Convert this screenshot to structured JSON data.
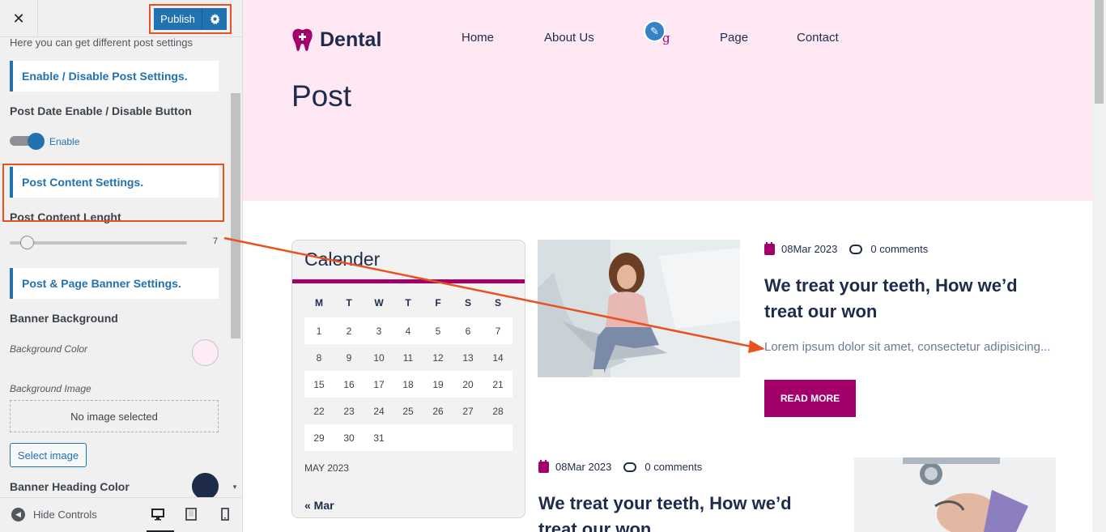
{
  "customizer": {
    "close_icon": "close-icon",
    "publish_label": "Publish",
    "settings_icon": "gear-icon",
    "panel_description": "Here you can get different post settings",
    "sections": {
      "enable_disable": "Enable / Disable Post Settings.",
      "post_content": "Post Content Settings.",
      "banner": "Post & Page Banner Settings."
    },
    "post_date": {
      "label": "Post Date Enable / Disable Button",
      "toggle_label": "Enable",
      "enabled": true
    },
    "content_length": {
      "label": "Post Content Lenght",
      "value": "7"
    },
    "banner_background_label": "Banner Background",
    "background_color_label": "Background Color",
    "background_color_value": "#fdebf6",
    "background_image_label": "Background Image",
    "no_image_text": "No image selected",
    "select_image_label": "Select image",
    "banner_heading_color_label": "Banner Heading Color",
    "banner_heading_color_value": "#1e2b4a",
    "footer": {
      "hide_controls_label": "Hide Controls",
      "devices": [
        "desktop",
        "tablet",
        "mobile"
      ],
      "active_device": "desktop"
    }
  },
  "site": {
    "logo_text": "Dental",
    "nav": [
      "Home",
      "About Us",
      "g",
      "Page",
      "Contact"
    ],
    "page_title": "Post",
    "colors": {
      "accent": "#a3006b",
      "banner_bg": "#fde8f4",
      "heading": "#1e2b4a",
      "publish": "#2271b1",
      "annotation": "#e8521f"
    }
  },
  "calendar": {
    "title": "Calender",
    "weekdays": [
      "M",
      "T",
      "W",
      "T",
      "F",
      "S",
      "S"
    ],
    "weeks": [
      [
        "",
        "",
        "",
        "",
        "",
        "",
        ""
      ],
      [
        "1",
        "2",
        "3",
        "4",
        "5",
        "6",
        "7"
      ],
      [
        "8",
        "9",
        "10",
        "11",
        "12",
        "13",
        "14"
      ],
      [
        "15",
        "16",
        "17",
        "18",
        "19",
        "20",
        "21"
      ],
      [
        "22",
        "23",
        "24",
        "25",
        "26",
        "27",
        "28"
      ],
      [
        "29",
        "30",
        "31",
        "",
        "",
        "",
        ""
      ]
    ],
    "caption": "MAY 2023",
    "prev_link": "« Mar"
  },
  "posts": [
    {
      "date": "08Mar 2023",
      "comments": "0 comments",
      "title_line1": "We treat your teeth, How we’d",
      "title_line2": "treat our won",
      "excerpt": "Lorem ipsum dolor sit amet, consectetur adipisicing...",
      "button": "READ MORE"
    },
    {
      "date": "08Mar 2023",
      "comments": "0 comments",
      "title_line1": "We treat your teeth, How we’d",
      "title_line2": "treat our won"
    }
  ]
}
